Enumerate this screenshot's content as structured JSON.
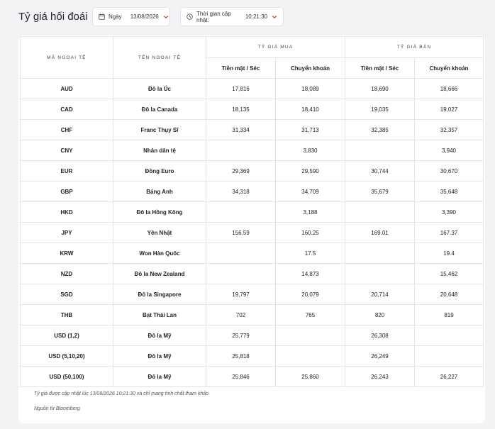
{
  "page": {
    "title": "Tỷ giá hối đoái"
  },
  "filters": {
    "date_label": "Ngày",
    "date_value": "13/08/2026",
    "time_label": "Thời gian cập nhật:",
    "time_value": "10:21:30",
    "icons": [
      "calendar-icon",
      "clock-icon",
      "chevron-down-icon"
    ]
  },
  "table": {
    "headers": {
      "code": "MÃ NGOẠI TỆ",
      "name": "TÊN NGOẠI TỆ",
      "buy": "TỶ GIÁ MUA",
      "sell": "TỶ GIÁ BÁN",
      "cash": "Tiền mặt / Séc",
      "transfer": "Chuyển khoản"
    },
    "rows": [
      {
        "code": "AUD",
        "name": "Đô la Úc",
        "buy_cash": "17,816",
        "buy_transfer": "18,089",
        "sell_cash": "18,690",
        "sell_transfer": "18,666"
      },
      {
        "code": "CAD",
        "name": "Đô la Canada",
        "buy_cash": "18,135",
        "buy_transfer": "18,410",
        "sell_cash": "19,035",
        "sell_transfer": "19,027"
      },
      {
        "code": "CHF",
        "name": "Franc Thụy Sĩ",
        "buy_cash": "31,334",
        "buy_transfer": "31,713",
        "sell_cash": "32,385",
        "sell_transfer": "32,357"
      },
      {
        "code": "CNY",
        "name": "Nhân dân tệ",
        "buy_cash": "",
        "buy_transfer": "3,830",
        "sell_cash": "",
        "sell_transfer": "3,940"
      },
      {
        "code": "EUR",
        "name": "Đồng Euro",
        "buy_cash": "29,369",
        "buy_transfer": "29,590",
        "sell_cash": "30,744",
        "sell_transfer": "30,670"
      },
      {
        "code": "GBP",
        "name": "Bảng Anh",
        "buy_cash": "34,318",
        "buy_transfer": "34,709",
        "sell_cash": "35,679",
        "sell_transfer": "35,648"
      },
      {
        "code": "HKD",
        "name": "Đô la Hồng Kông",
        "buy_cash": "",
        "buy_transfer": "3,188",
        "sell_cash": "",
        "sell_transfer": "3,390"
      },
      {
        "code": "JPY",
        "name": "Yên Nhật",
        "buy_cash": "156.59",
        "buy_transfer": "160.25",
        "sell_cash": "169.01",
        "sell_transfer": "167.37"
      },
      {
        "code": "KRW",
        "name": "Won Hàn Quốc",
        "buy_cash": "",
        "buy_transfer": "17.5",
        "sell_cash": "",
        "sell_transfer": "19.4"
      },
      {
        "code": "NZD",
        "name": "Đô la New Zealand",
        "buy_cash": "",
        "buy_transfer": "14,873",
        "sell_cash": "",
        "sell_transfer": "15,462"
      },
      {
        "code": "SGD",
        "name": "Đô la Singapore",
        "buy_cash": "19,797",
        "buy_transfer": "20,079",
        "sell_cash": "20,714",
        "sell_transfer": "20,648"
      },
      {
        "code": "THB",
        "name": "Bạt Thái Lan",
        "buy_cash": "702",
        "buy_transfer": "765",
        "sell_cash": "820",
        "sell_transfer": "819"
      },
      {
        "code": "USD (1,2)",
        "name": "Đô la Mỹ",
        "buy_cash": "25,779",
        "buy_transfer": "",
        "sell_cash": "26,308",
        "sell_transfer": ""
      },
      {
        "code": "USD (5,10,20)",
        "name": "Đô la Mỹ",
        "buy_cash": "25,818",
        "buy_transfer": "",
        "sell_cash": "26,249",
        "sell_transfer": ""
      },
      {
        "code": "USD (50,100)",
        "name": "Đô la Mỹ",
        "buy_cash": "25,846",
        "buy_transfer": "25,860",
        "sell_cash": "26,243",
        "sell_transfer": "26,227"
      }
    ]
  },
  "footer": {
    "note": "Tỷ giá được cập nhật lúc 13/08/2026 10:21:30 và chỉ mang tính chất tham khảo",
    "source": "Nguồn từ Bloomberg"
  }
}
